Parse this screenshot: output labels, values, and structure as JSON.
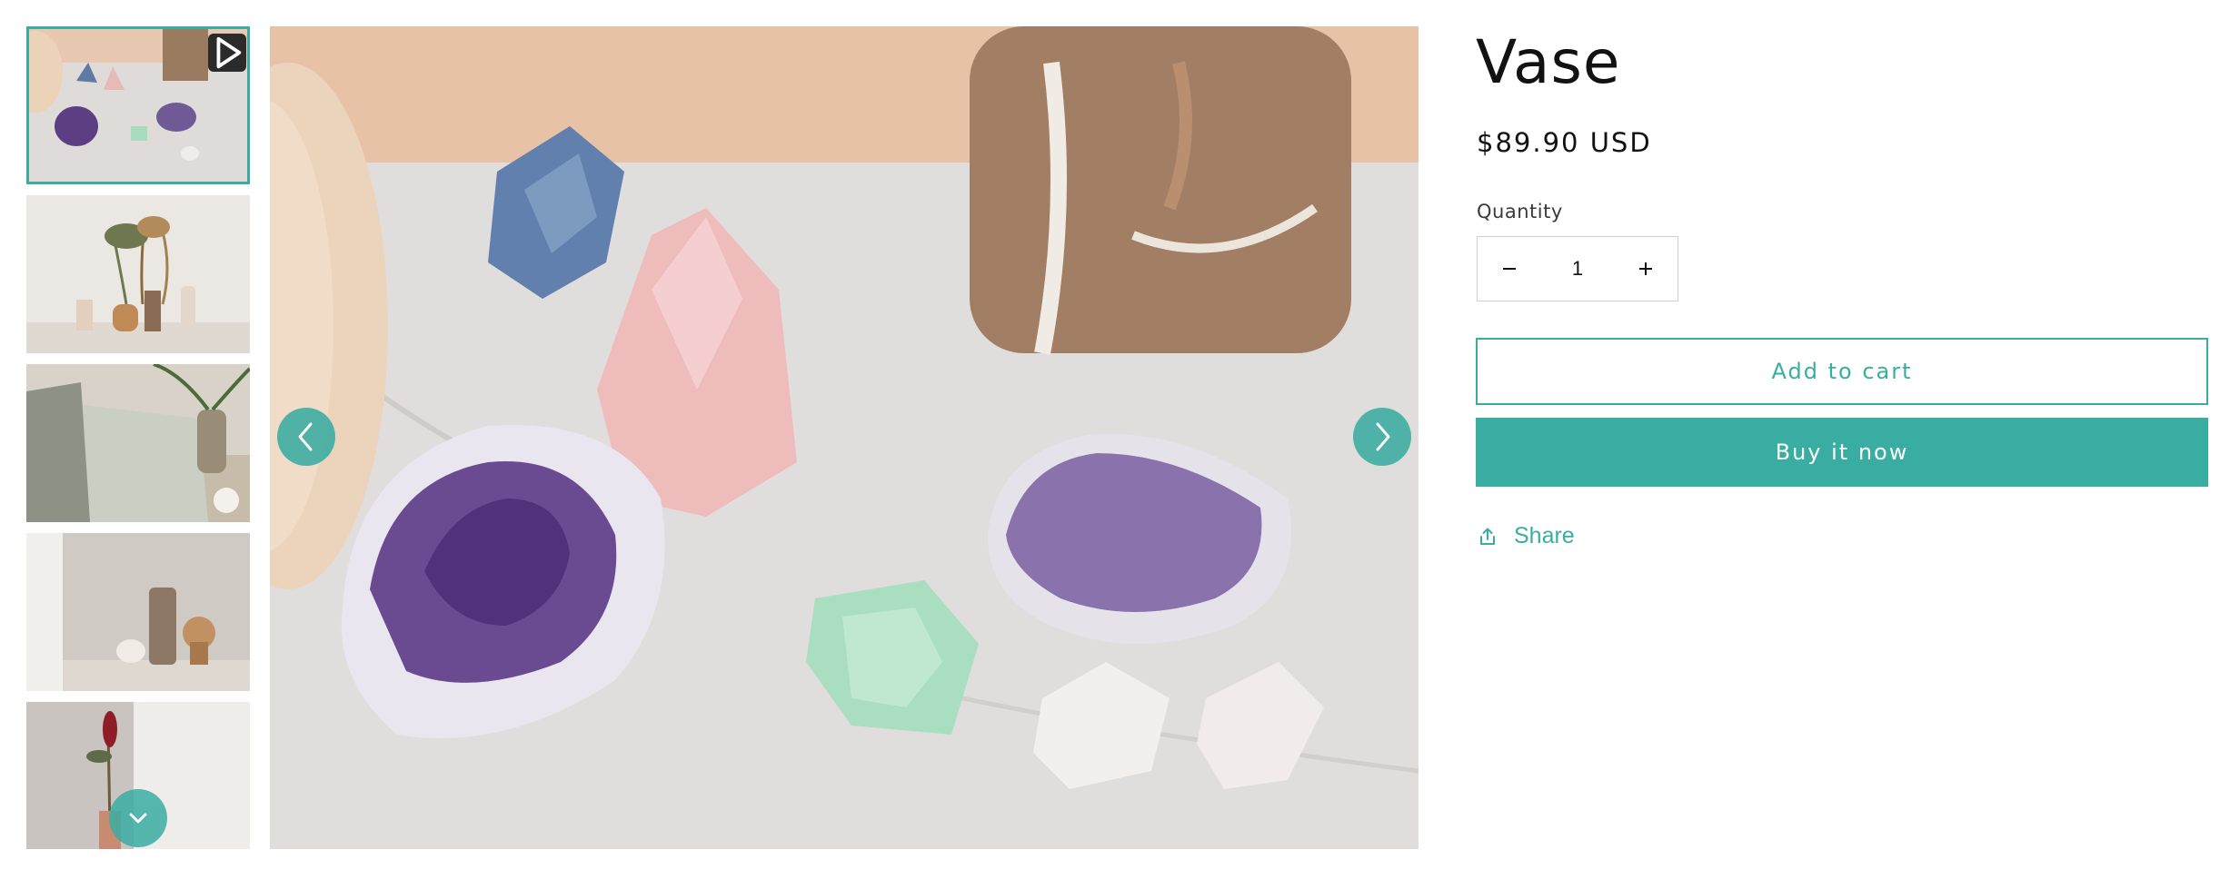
{
  "product": {
    "title": "Vase",
    "price": "$89.90 USD"
  },
  "quantity": {
    "label": "Quantity",
    "value": "1",
    "decrease_icon": "minus-icon",
    "increase_icon": "plus-icon"
  },
  "actions": {
    "add_to_cart": "Add to cart",
    "buy_now": "Buy it now",
    "share": "Share",
    "share_icon": "share-icon"
  },
  "gallery": {
    "thumbnails": [
      {
        "subject": "crystals",
        "active": true,
        "video": true
      },
      {
        "subject": "dried-flowers-vases",
        "active": false
      },
      {
        "subject": "book-and-plant",
        "active": false
      },
      {
        "subject": "wooden-vases",
        "active": false
      },
      {
        "subject": "red-flower-vase",
        "active": false
      }
    ],
    "main_subject": "crystals-on-marble",
    "icons": {
      "play": "play-icon",
      "prev": "chevron-left-icon",
      "next": "chevron-right-icon",
      "scroll": "chevron-down-icon"
    }
  },
  "colors": {
    "accent": "#3aada3",
    "text": "#121212"
  }
}
